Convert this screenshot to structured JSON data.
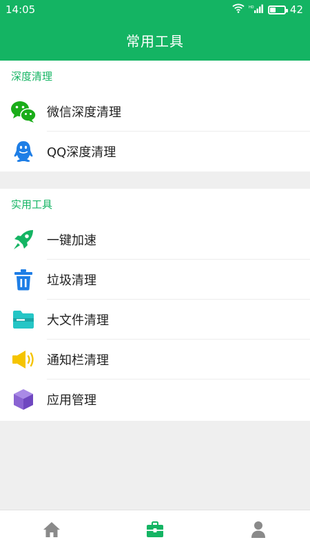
{
  "status_bar": {
    "time": "14:05",
    "battery_level": "42",
    "battery_fraction": 0.42
  },
  "header": {
    "title": "常用工具"
  },
  "sections": [
    {
      "label": "深度清理",
      "items": [
        {
          "label": "微信深度清理",
          "icon": "wechat-icon",
          "color": "#1aad19"
        },
        {
          "label": "QQ深度清理",
          "icon": "qq-icon",
          "color": "#1e7ee6"
        }
      ]
    },
    {
      "label": "实用工具",
      "items": [
        {
          "label": "一键加速",
          "icon": "rocket-icon",
          "color": "#14b463"
        },
        {
          "label": "垃圾清理",
          "icon": "trash-icon",
          "color": "#1e7ee6"
        },
        {
          "label": "大文件清理",
          "icon": "folder-icon",
          "color": "#25c6c6"
        },
        {
          "label": "通知栏清理",
          "icon": "speaker-icon",
          "color": "#f5c400"
        },
        {
          "label": "应用管理",
          "icon": "cube-icon",
          "color": "#8a63d2"
        }
      ]
    }
  ],
  "bottom_nav": {
    "items": [
      {
        "icon": "home-icon",
        "active": false
      },
      {
        "icon": "toolbox-icon",
        "active": true
      },
      {
        "icon": "user-icon",
        "active": false
      }
    ],
    "active_color": "#14b463",
    "inactive_color": "#8a8a8a"
  },
  "colors": {
    "brand": "#14b463",
    "background": "#efefef"
  }
}
